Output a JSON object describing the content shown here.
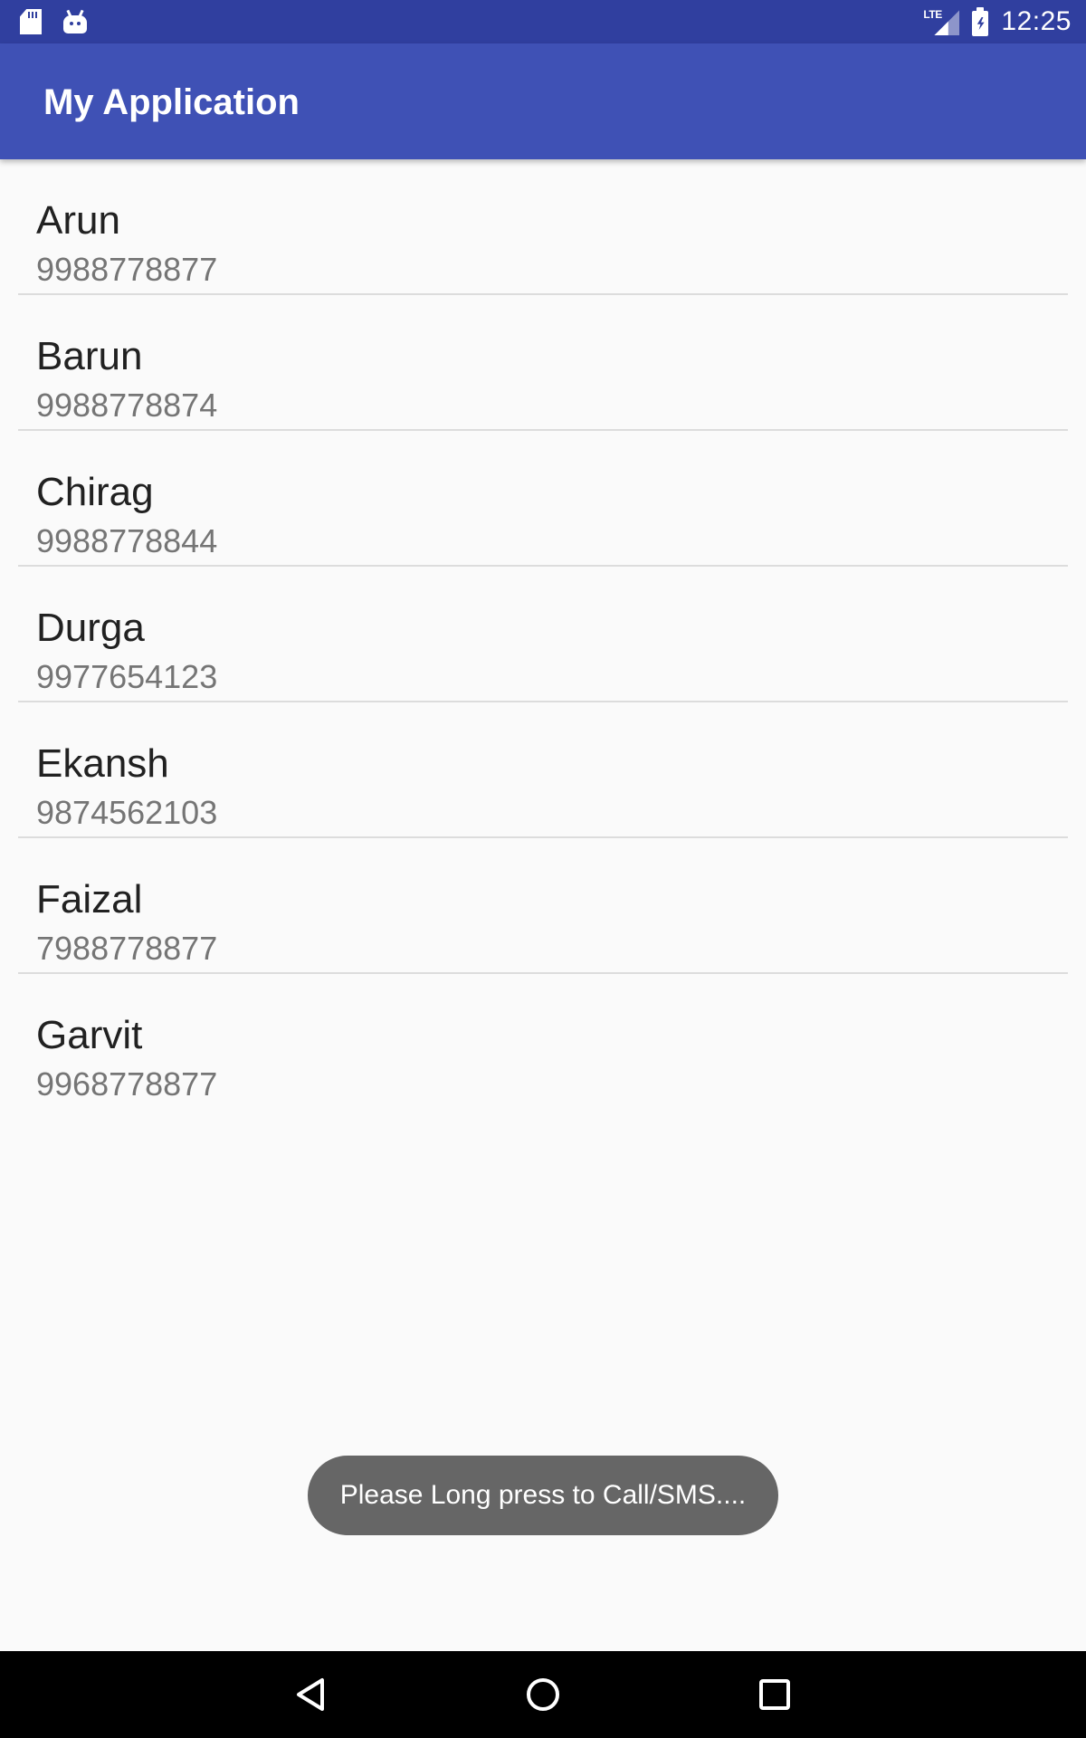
{
  "status_bar": {
    "time": "12:25",
    "network_label": "LTE",
    "left_icons": [
      "sd-card-icon",
      "android-icon"
    ],
    "right_icons": [
      "signal-icon",
      "battery-charging-icon"
    ]
  },
  "app_bar": {
    "title": "My Application",
    "color": "#3f51b5",
    "status_color": "#303f9f"
  },
  "contacts": [
    {
      "name": "Arun",
      "phone": "9988778877"
    },
    {
      "name": "Barun",
      "phone": "9988778874"
    },
    {
      "name": "Chirag",
      "phone": "9988778844"
    },
    {
      "name": "Durga",
      "phone": "9977654123"
    },
    {
      "name": "Ekansh",
      "phone": "9874562103"
    },
    {
      "name": "Faizal",
      "phone": "7988778877"
    },
    {
      "name": "Garvit",
      "phone": "9968778877"
    }
  ],
  "toast": {
    "message": "Please Long press to Call/SMS...."
  },
  "nav_bar": {
    "buttons": [
      "back-icon",
      "home-icon",
      "recents-icon"
    ]
  }
}
